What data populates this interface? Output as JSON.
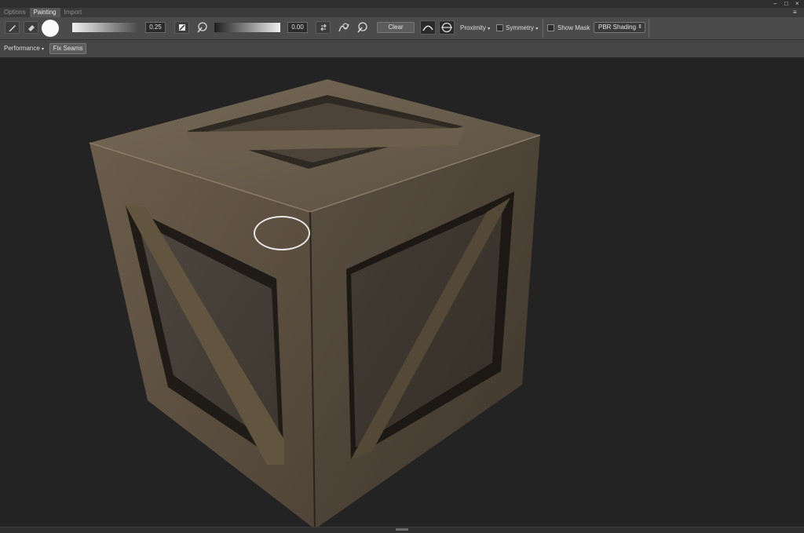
{
  "tabs": [
    {
      "label": "Options",
      "active": false
    },
    {
      "label": "Painting",
      "active": true
    },
    {
      "label": "Import",
      "active": false
    }
  ],
  "window_controls": {
    "minimize": "–",
    "maximize": "□",
    "close": "×",
    "menu": "≡"
  },
  "toolbar": {
    "brush_tool": "brush-icon",
    "eraser_tool": "eraser-icon",
    "brush_preview": "brush-circle-icon",
    "opacity_value": "0.25",
    "opacity_icon": "pressure-pen-icon",
    "color_picker_icon": "eyedropper-icon",
    "flow_value": "0.00",
    "swap_icon": "swap-icon",
    "smudge_icon": "smudge-icon",
    "picker2_icon": "eyedropper-icon",
    "clear_label": "Clear",
    "proximity_label": "Proximity",
    "symmetry_label": "Symmetry",
    "show_mask_label": "Show Mask",
    "shading_mode": "PBR Shading"
  },
  "toolbar2": {
    "performance_label": "Performance",
    "fix_seams_label": "Fix Seams"
  },
  "colors": {
    "accent": "#4f4f4f",
    "viewport_bg": "#232323",
    "wood_light": "#7a6c58",
    "wood_dark": "#3c3329"
  },
  "viewport": {
    "model": "wooden crate",
    "brush_cursor_icon": "brush-cursor-circle-icon"
  }
}
